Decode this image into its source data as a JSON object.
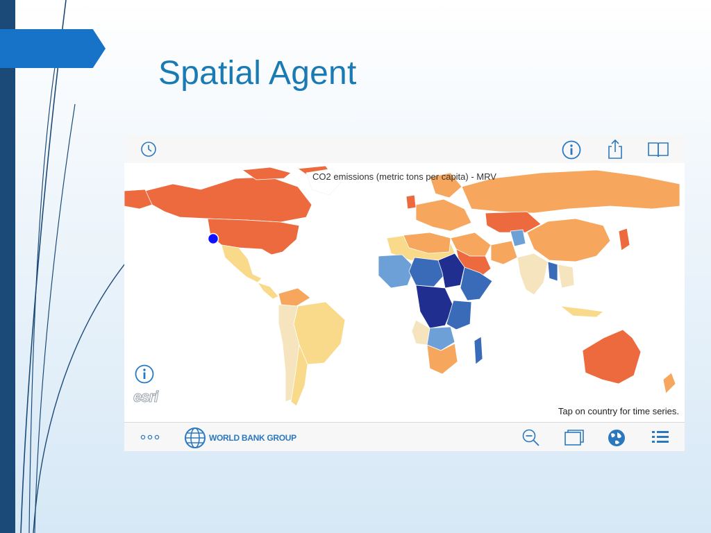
{
  "slide": {
    "title": "Spatial Agent"
  },
  "app": {
    "map_title": "CO2 emissions (metric tons per capita) - MRV",
    "hint": "Tap on country for time series.",
    "esri_logo": "esri",
    "brand": "WORLD BANK GROUP",
    "toolbar_top": {
      "left": [
        "clock-icon"
      ],
      "right": [
        "info-icon",
        "share-icon",
        "book-icon"
      ]
    },
    "toolbar_bottom": [
      "more-icon",
      "zoom-out-icon",
      "layers-icon",
      "globe-icon",
      "list-icon"
    ],
    "location_marker_color": "#1010ff"
  },
  "colors": {
    "accent": "#1673c7",
    "band": "#1b4a78",
    "title": "#1a7bb4",
    "icon": "#2a78c0",
    "high": "#ec6a3e",
    "mid": "#f6a65d",
    "low": "#f9d98a",
    "lower": "#f5e4bd",
    "blue_light": "#6ca0d6",
    "blue_mid": "#3a6bb8",
    "blue_dark": "#1f2e8f"
  }
}
